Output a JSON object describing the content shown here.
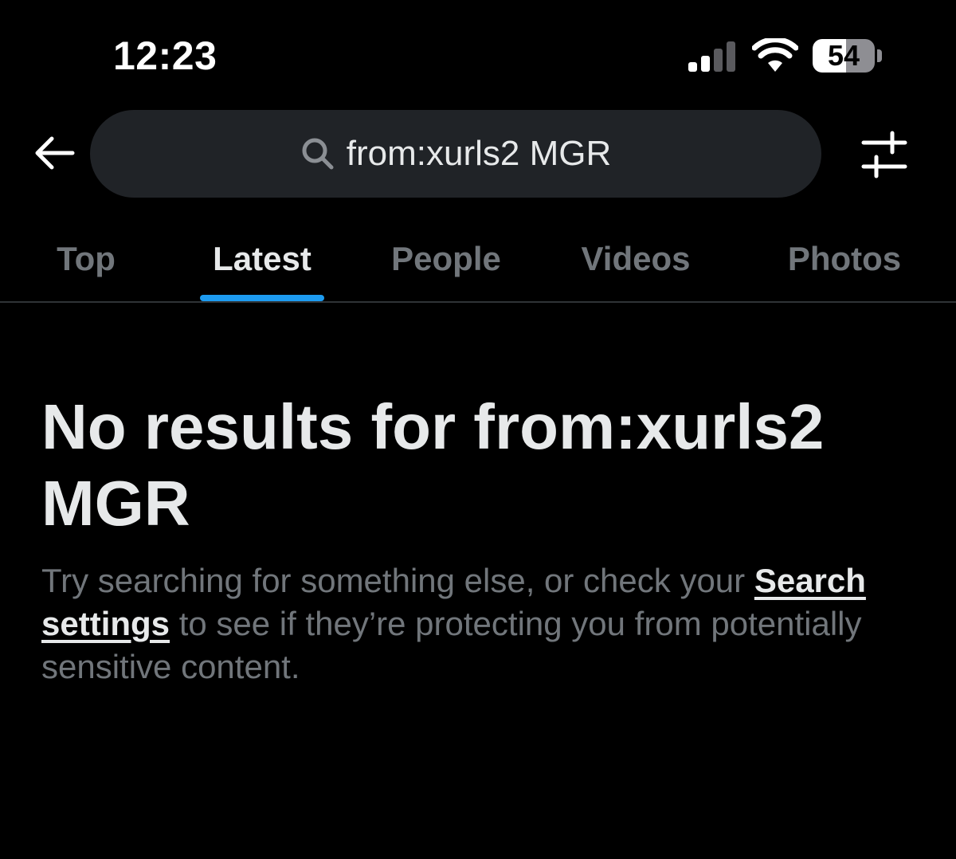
{
  "status_bar": {
    "time": "12:23",
    "battery_level": "54",
    "battery_fraction": 0.54,
    "signal_bars_active": 2,
    "signal_bars_total": 4,
    "icons": [
      "signal-icon",
      "wifi-icon",
      "battery-icon"
    ]
  },
  "header": {
    "back_icon": "back-arrow-icon",
    "search_icon": "search-icon",
    "search_query": "from:xurls2 MGR",
    "filter_icon": "sliders-icon"
  },
  "tabs": [
    {
      "label": "Top",
      "active": false
    },
    {
      "label": "Latest",
      "active": true
    },
    {
      "label": "People",
      "active": false
    },
    {
      "label": "Videos",
      "active": false
    },
    {
      "label": "Photos",
      "active": false
    }
  ],
  "empty_state": {
    "title": "No results for from:xurls2 MGR",
    "body_before_link": "Try searching for something else, or check your ",
    "link_label": "Search settings",
    "body_after_link": " to see if they’re protecting you from potentially sensitive content."
  },
  "colors": {
    "background": "#000000",
    "primary_text": "#e7e9ea",
    "secondary_text": "#71767b",
    "accent": "#1d9bf0",
    "search_bg": "#202327",
    "divider": "#2f3336"
  }
}
